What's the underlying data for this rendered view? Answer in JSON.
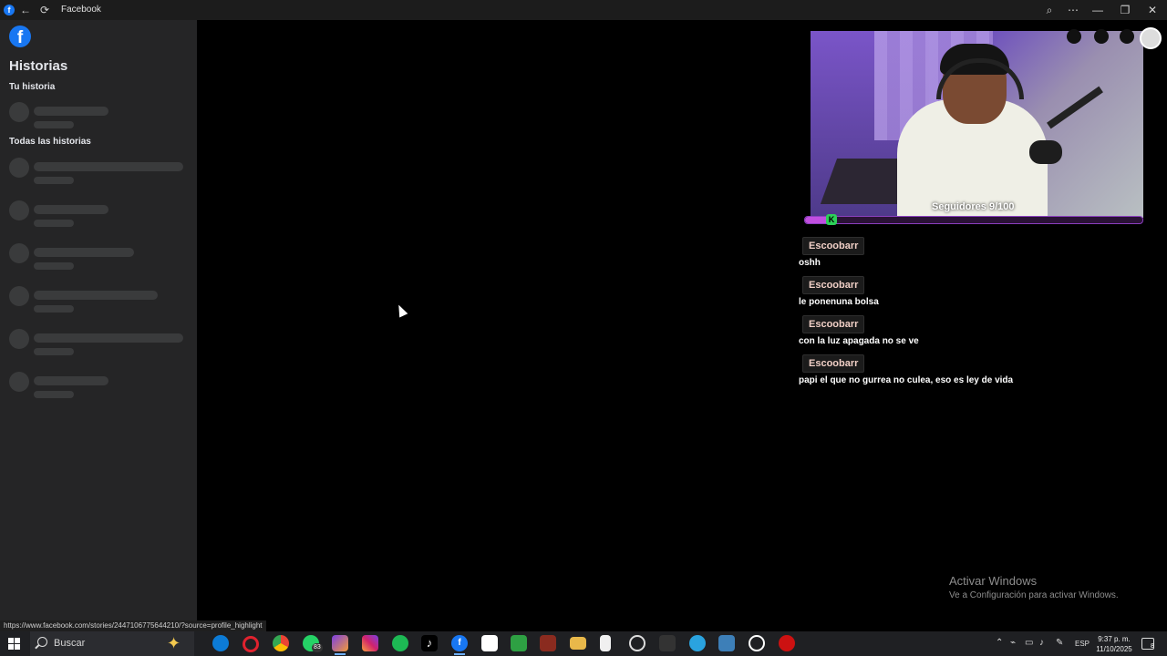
{
  "window": {
    "title": "Facebook",
    "back_glyph": "←",
    "refresh_glyph": "⟳",
    "zoom_glyph": "⌕",
    "more_glyph": "⋯",
    "minimize_glyph": "—",
    "maximize_glyph": "❐",
    "close_glyph": "✕"
  },
  "sidebar": {
    "logo_letter": "f",
    "title": "Historias",
    "your_story_label": "Tu historia",
    "all_stories_label": "Todas las historias"
  },
  "stream": {
    "followers_label": "Seguidores 9/100",
    "followers_progress": 0.09,
    "kick_letter": "K"
  },
  "chat": [
    {
      "user": "Escoobarr",
      "text": "oshh"
    },
    {
      "user": "Escoobarr",
      "text": "le ponenuna bolsa"
    },
    {
      "user": "Escoobarr",
      "text": "con la luz apagada no se ve"
    },
    {
      "user": "Escoobarr",
      "text": "papi el que no gurrea no culea, eso es ley de vida"
    }
  ],
  "watermark": {
    "title": "Activar Windows",
    "subtitle": "Ve a Configuración para activar Windows."
  },
  "status_url": "https://www.facebook.com/stories/2447106775644210/?source=profile_highlight",
  "taskbar": {
    "search_placeholder": "Buscar",
    "whatsapp_badge": "83",
    "language": "ESP",
    "time": "9:37 p. m.",
    "date": "11/10/2025",
    "notification_count": "8"
  },
  "colors": {
    "facebook_blue": "#1877f2",
    "chat_username": "#f0cfc6",
    "progress_fill": "#c14fe0",
    "kick_green": "#2cd158"
  }
}
